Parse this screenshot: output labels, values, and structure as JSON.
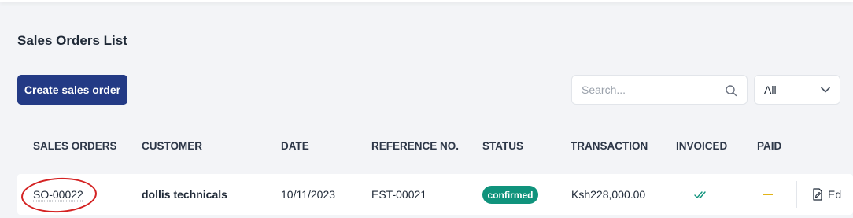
{
  "header": {
    "title": "Sales Orders List"
  },
  "toolbar": {
    "create_label": "Create sales order",
    "search_placeholder": "Search...",
    "filter_value": "All"
  },
  "table": {
    "columns": [
      "SALES ORDERS",
      "CUSTOMER",
      "DATE",
      "REFERENCE NO.",
      "STATUS",
      "TRANSACTION",
      "INVOICED",
      "PAID"
    ],
    "rows": [
      {
        "order": "SO-00022",
        "customer": "dollis technicals",
        "date": "10/11/2023",
        "reference": "EST-00021",
        "status": "confirmed",
        "transaction": "Ksh228,000.00",
        "invoiced_icon": "double-check-icon",
        "paid_icon": "dash-icon",
        "action": "Ed"
      }
    ]
  },
  "colors": {
    "primary": "#233a85",
    "status_confirmed": "#10937c",
    "highlight_circle": "#d42222",
    "paid_pending": "#e2b418"
  }
}
